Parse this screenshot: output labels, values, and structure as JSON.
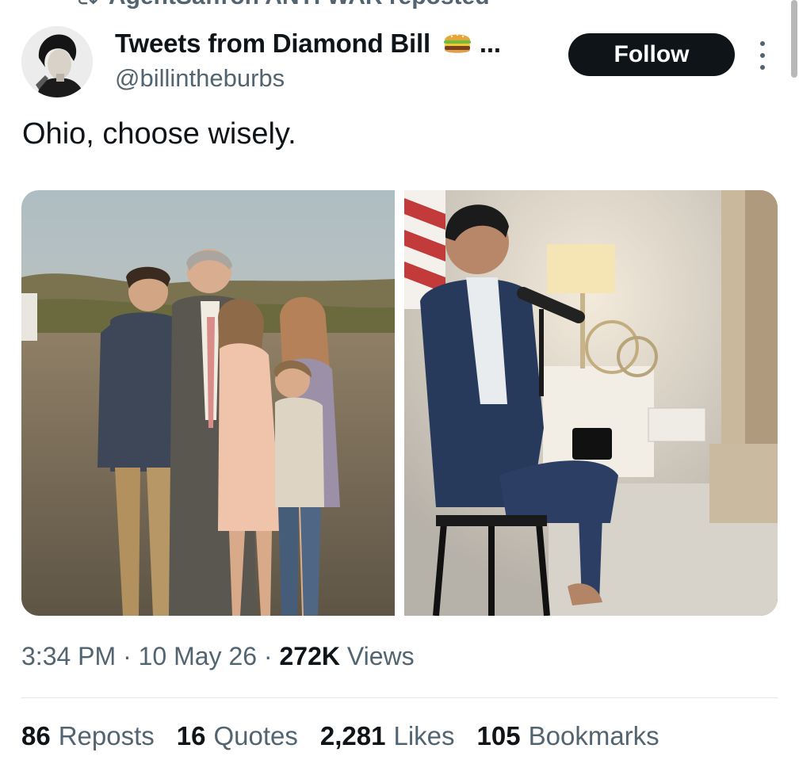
{
  "repost_header": {
    "text": "AgentSaffron ANTI WAR reposted"
  },
  "author": {
    "name": "Tweets from Diamond Bill",
    "name_emoji": "🍔",
    "name_ellipsis": "...",
    "handle": "@billintheburbs"
  },
  "follow_button": {
    "label": "Follow"
  },
  "tweet": {
    "text": "Ohio, choose wisely."
  },
  "meta": {
    "time": "3:34 PM",
    "separator": "·",
    "date": "10 May 26",
    "views_count": "272K",
    "views_label": "Views"
  },
  "stats": [
    {
      "count": "86",
      "label": "Reposts"
    },
    {
      "count": "16",
      "label": "Quotes"
    },
    {
      "count": "2,281",
      "label": "Likes"
    },
    {
      "count": "105",
      "label": "Bookmarks"
    }
  ],
  "colors": {
    "text": "#0f1419",
    "secondary": "#536471",
    "button_bg": "#0f1419",
    "divider": "#e1e6ea"
  }
}
